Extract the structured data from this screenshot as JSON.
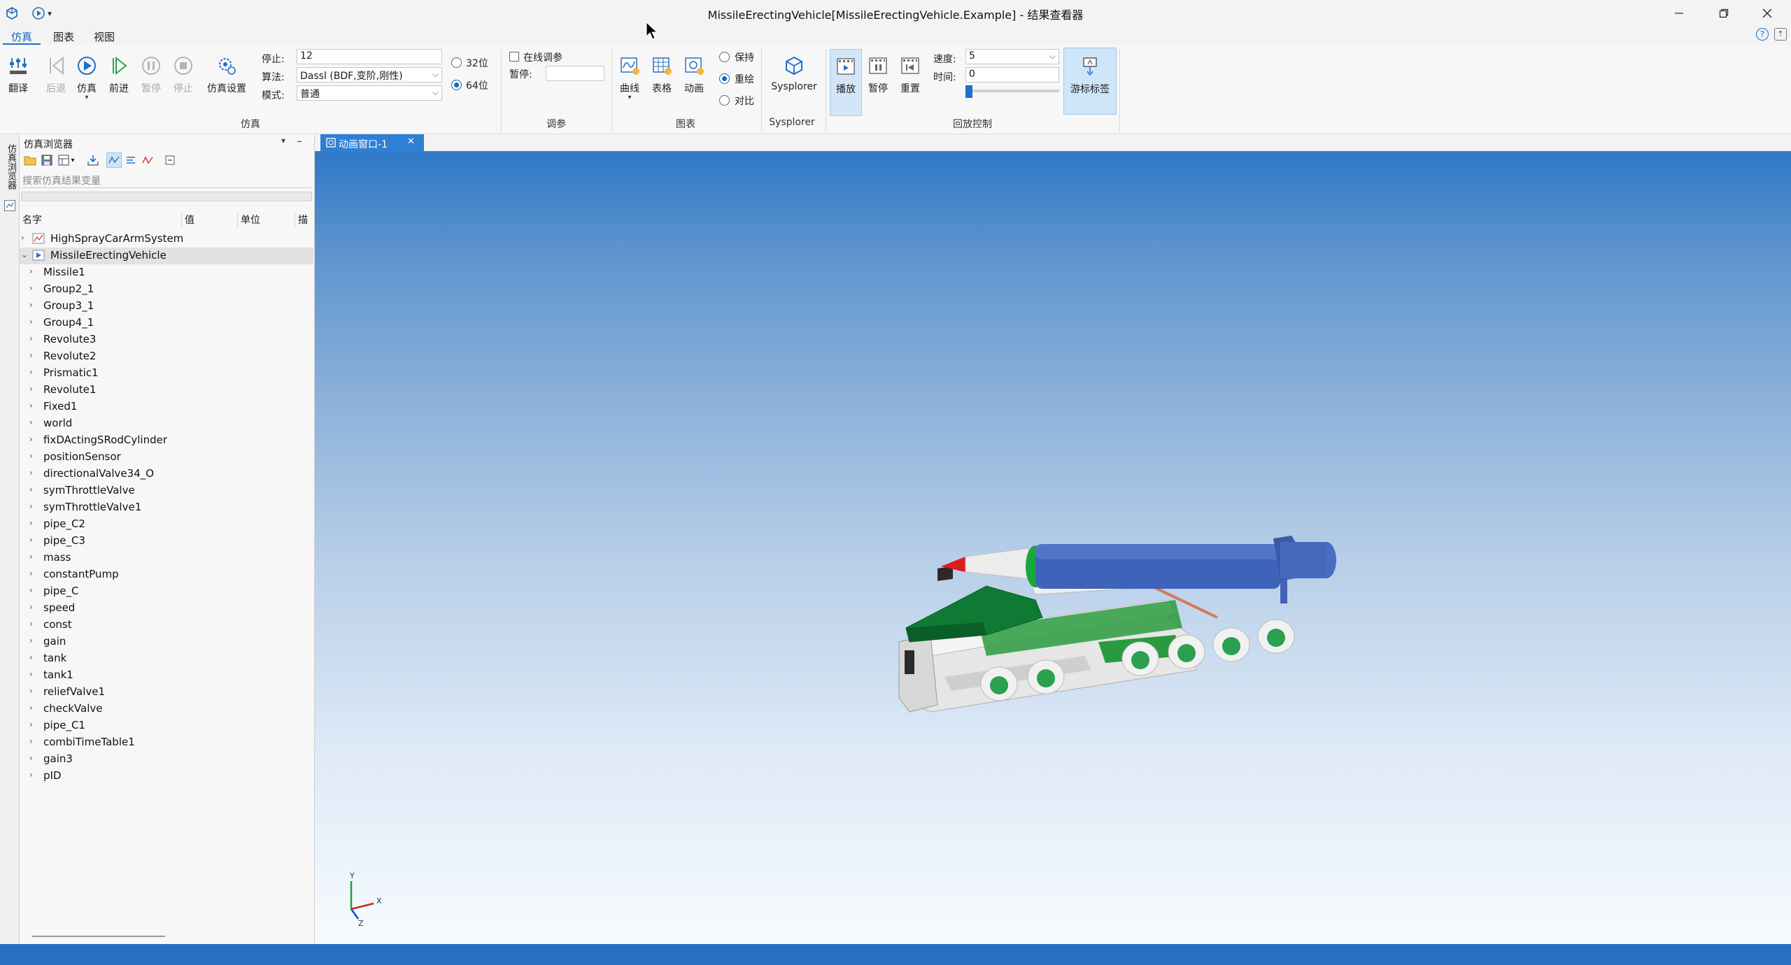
{
  "window": {
    "title": "MissileErectingVehicle[MissileErectingVehicle.Example] - 结果查看器"
  },
  "menu": {
    "tabs": [
      {
        "label": "仿真"
      },
      {
        "label": "图表"
      },
      {
        "label": "视图"
      }
    ]
  },
  "ribbon": {
    "compile_label": "翻译",
    "back_label": "后退",
    "simulate_label": "仿真",
    "forward_label": "前进",
    "pause_label": "暂停",
    "stop_label": "停止",
    "settings_label": "仿真设置",
    "stop_time_label": "停止:",
    "stop_time_value": "12",
    "algorithm_label": "算法:",
    "algorithm_value": "Dassl (BDF,变阶,刚性)",
    "mode_label": "模式:",
    "mode_value": "普通",
    "bit32_label": "32位",
    "bit64_label": "64位",
    "group_sim_label": "仿真",
    "online_tune_label": "在线调参",
    "pause_at_label": "暂停:",
    "pause_at_value": "",
    "group_tune_label": "调参",
    "curve_label": "曲线",
    "table_label": "表格",
    "animation_label": "动画",
    "keep_label": "保持",
    "redraw_label": "重绘",
    "compare_label": "对比",
    "group_chart_label": "图表",
    "sysplorer_label": "Sysplorer",
    "group_sysplorer_label": "Sysplorer",
    "play_label": "播放",
    "pb_pause_label": "暂停",
    "reset_label": "重置",
    "speed_label": "速度:",
    "speed_value": "5",
    "time_label": "时间:",
    "time_value": "0",
    "cursor_tag_label": "游标标签",
    "group_playback_label": "回放控制",
    "slider_value": 0
  },
  "left_strip": {
    "label": "仿真浏览器"
  },
  "browser": {
    "title": "仿真浏览器",
    "search_placeholder": "搜索仿真结果变量",
    "columns": [
      "名字",
      "值",
      "单位",
      "描"
    ],
    "roots": [
      "HighSprayCarArmSystem",
      "MissileErectingVehicle"
    ],
    "children": [
      "Missile1",
      "Group2_1",
      "Group3_1",
      "Group4_1",
      "Revolute3",
      "Revolute2",
      "Prismatic1",
      "Revolute1",
      "Fixed1",
      "world",
      "fixDActingSRodCylinder",
      "positionSensor",
      "directionalValve34_O",
      "symThrottleValve",
      "symThrottleValve1",
      "pipe_C2",
      "pipe_C3",
      "mass",
      "constantPump",
      "pipe_C",
      "speed",
      "const",
      "gain",
      "tank",
      "tank1",
      "reliefValve1",
      "checkValve",
      "pipe_C1",
      "combiTimeTable1",
      "gain3",
      "pID"
    ]
  },
  "view": {
    "tab_label": "动画窗口-1",
    "axis_x": "X",
    "axis_y": "Y",
    "axis_z": "Z"
  },
  "colors": {
    "accent": "#1e6fd0",
    "status_bar": "#2a6fbf",
    "vehicle_green": "#2a9a3e",
    "missile_blue": "#3f63b8"
  }
}
